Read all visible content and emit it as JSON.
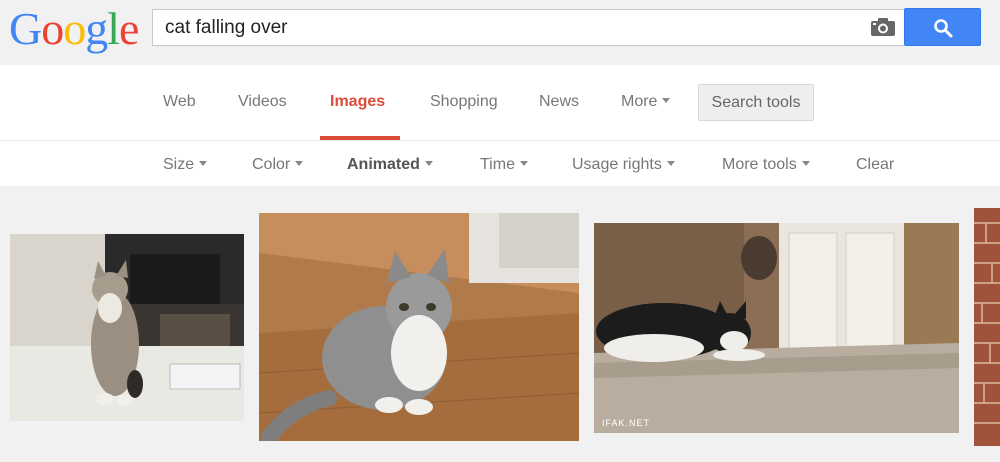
{
  "logo": {
    "letters": [
      "G",
      "o",
      "o",
      "g",
      "l",
      "e"
    ],
    "colors": [
      "#4285f4",
      "#ea4335",
      "#fbbc05",
      "#4285f4",
      "#34a853",
      "#ea4335"
    ]
  },
  "search": {
    "query": "cat falling over",
    "camera_icon": "camera-icon",
    "button_icon": "magnifier-icon"
  },
  "nav": {
    "tabs": [
      {
        "label": "Web"
      },
      {
        "label": "Videos"
      },
      {
        "label": "Images",
        "active": true
      },
      {
        "label": "Shopping"
      },
      {
        "label": "News"
      },
      {
        "label": "More"
      }
    ],
    "search_tools": "Search tools"
  },
  "tools": [
    "Size",
    "Color",
    "Animated",
    "Time",
    "Usage rights",
    "More tools",
    "Clear"
  ],
  "results": {
    "watermark": "IFAK.NET",
    "accent": "#dd4b39",
    "brand_blue": "#4285f4"
  }
}
